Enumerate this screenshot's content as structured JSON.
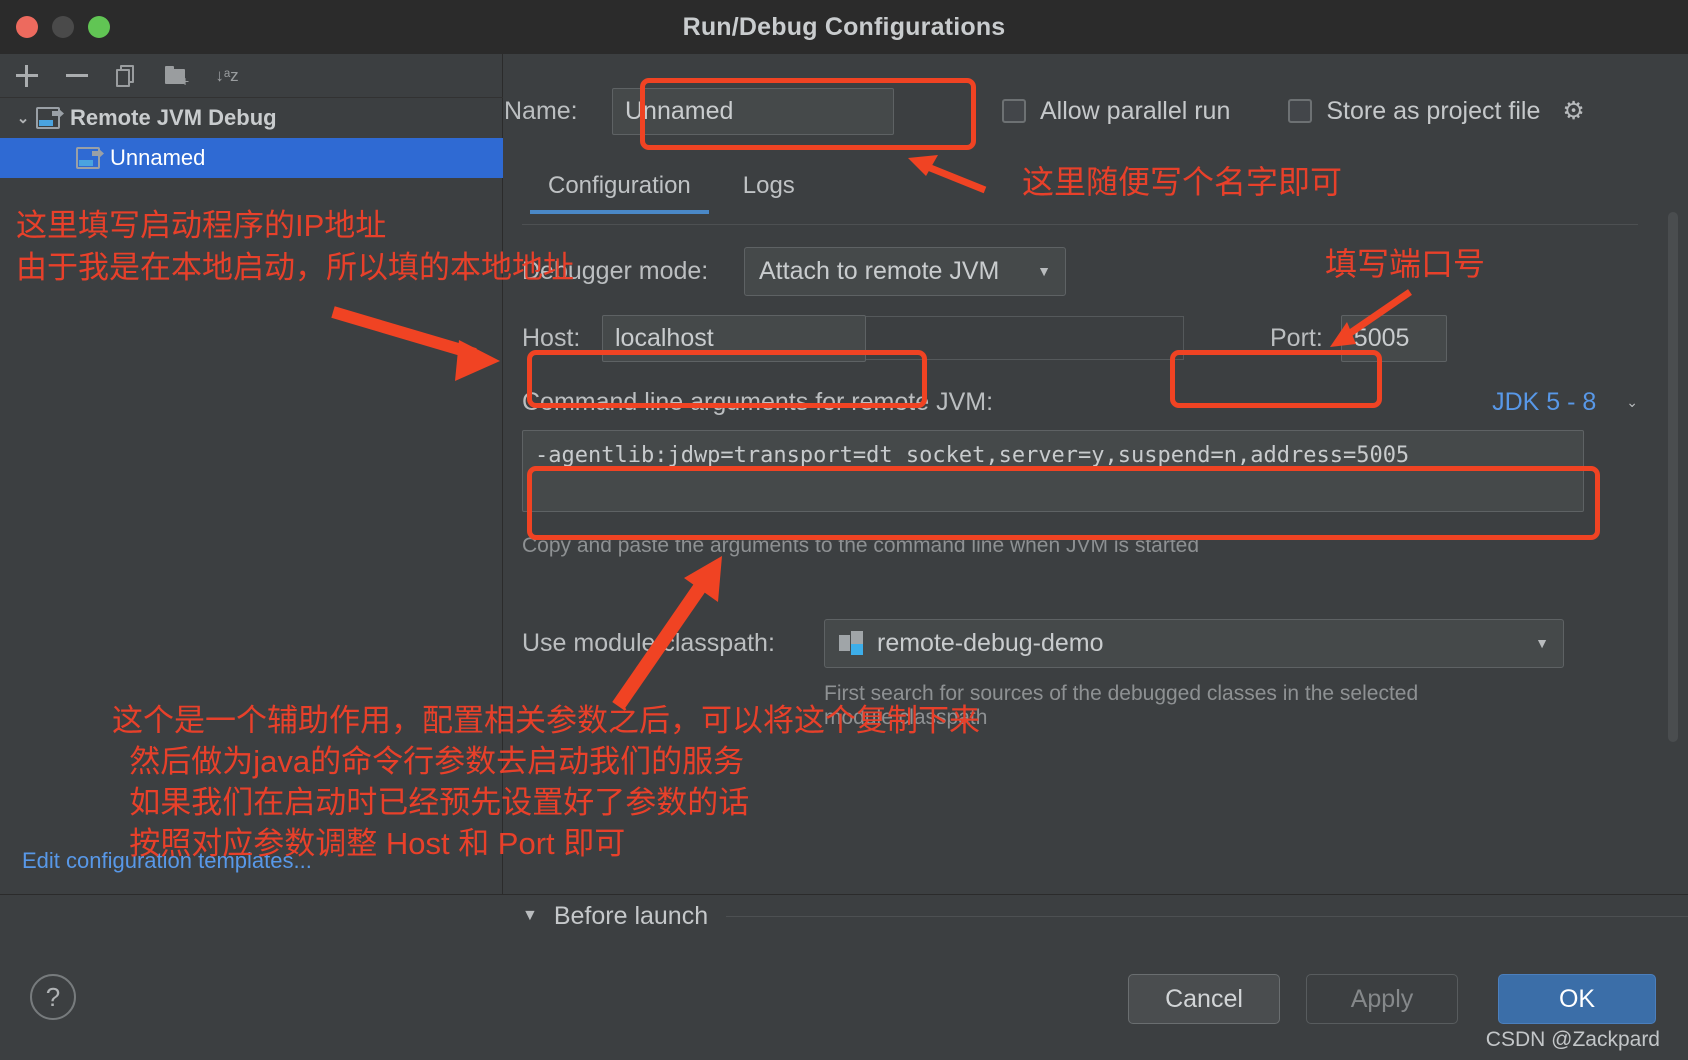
{
  "window": {
    "title": "Run/Debug Configurations",
    "traffic_lights": [
      "close",
      "minimize",
      "zoom"
    ]
  },
  "toolbar": {
    "buttons": [
      {
        "name": "add",
        "icon": "plus-icon"
      },
      {
        "name": "remove",
        "icon": "minus-icon"
      },
      {
        "name": "copy",
        "icon": "copy-icon"
      },
      {
        "name": "new-folder",
        "icon": "folder-add-icon"
      },
      {
        "name": "sort",
        "icon": "sort-alpha-icon"
      }
    ]
  },
  "sidebar": {
    "tree": [
      {
        "label": "Remote JVM Debug",
        "level": 0,
        "expanded": true,
        "selected": false
      },
      {
        "label": "Unnamed",
        "level": 1,
        "expanded": false,
        "selected": true
      }
    ],
    "edit_templates_link": "Edit configuration templates...",
    "sort_glyph": "↓ᵃz"
  },
  "form": {
    "name_label": "Name:",
    "name_value": "Unnamed",
    "allow_parallel_run": {
      "label": "Allow parallel run",
      "checked": false
    },
    "store_as_project_file": {
      "label": "Store as project file",
      "checked": false,
      "gear": "⚙"
    },
    "tabs": [
      {
        "label": "Configuration",
        "active": true
      },
      {
        "label": "Logs",
        "active": false
      }
    ],
    "debugger_mode_label": "Debugger mode:",
    "debugger_mode_value": "Attach to remote JVM",
    "host_label": "Host:",
    "host_value": "localhost",
    "port_label": "Port:",
    "port_value": "5005",
    "command_line_label": "Command line arguments for remote JVM:",
    "jdk_selector": "JDK 5 - 8",
    "command_line_value": "-agentlib:jdwp=transport=dt_socket,server=y,suspend=n,address=5005",
    "command_hint": "Copy and paste the arguments to the command line when JVM is started",
    "module_classpath_label": "Use module classpath:",
    "module_classpath_value": "remote-debug-demo",
    "module_hint_line1": "First search for sources of the debugged classes in the selected",
    "module_hint_line2": "module classpath"
  },
  "before_launch": {
    "label": "Before launch",
    "expanded": true
  },
  "footer": {
    "help": "?",
    "cancel": "Cancel",
    "apply": "Apply",
    "ok": "OK",
    "watermark": "CSDN @Zackpard"
  },
  "annotations": [
    {
      "id": "name-note",
      "text": "这里随便写个名字即可"
    },
    {
      "id": "port-note",
      "text": "填写端口号"
    },
    {
      "id": "host-note",
      "text": "这里填写启动程序的IP地址\n由于我是在本地启动，所以填的本地地址"
    },
    {
      "id": "cmd-note",
      "text": "这个是一个辅助作用，配置相关参数之后，可以将这个复制下来\n  然后做为java的命令行参数去启动我们的服务\n  如果我们在启动时已经预先设置好了参数的话\n  按照对应参数调整 Host 和 Port 即可"
    }
  ],
  "colors": {
    "accent_red": "#f04323",
    "link_blue": "#5898e8",
    "selection_blue": "#2f6ad3",
    "ok_button": "#3b6ea8",
    "panel_bg": "#3c3f41",
    "titlebar_bg": "#2b2b2b"
  }
}
